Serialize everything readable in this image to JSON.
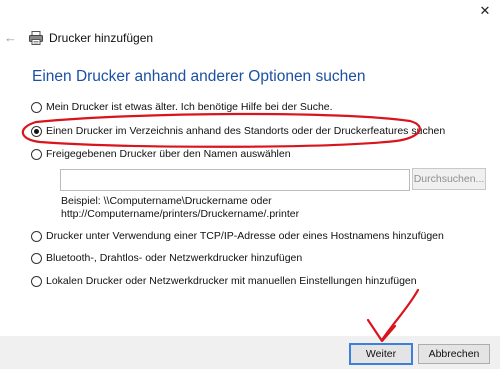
{
  "window": {
    "close_glyph": "✕",
    "back_glyph": "←",
    "title": "Drucker hinzufügen"
  },
  "heading": "Einen Drucker anhand anderer Optionen suchen",
  "options": [
    {
      "label": "Mein Drucker ist etwas älter. Ich benötige Hilfe bei der Suche.",
      "checked": false
    },
    {
      "label": "Einen Drucker im Verzeichnis anhand des Standorts oder der Druckerfeatures suchen",
      "checked": true
    },
    {
      "label": "Freigegebenen Drucker über den Namen auswählen",
      "checked": false
    },
    {
      "label": "Drucker unter Verwendung einer TCP/IP-Adresse oder eines Hostnamens hinzufügen",
      "checked": false
    },
    {
      "label": "Bluetooth-, Drahtlos- oder Netzwerkdrucker hinzufügen",
      "checked": false
    },
    {
      "label": "Lokalen Drucker oder Netzwerkdrucker mit manuellen Einstellungen hinzufügen",
      "checked": false
    }
  ],
  "shared_printer": {
    "input_value": "",
    "browse_label": "Durchsuchen...",
    "example_line1": "Beispiel: \\\\Computername\\Druckername oder",
    "example_line2": "http://Computername/printers/Druckername/.printer"
  },
  "footer": {
    "next_label": "Weiter",
    "cancel_label": "Abbrechen"
  },
  "colors": {
    "heading": "#1c50a4",
    "annotation": "#d9141c",
    "primary_button_border": "#3c7fdc"
  },
  "icons": {
    "close": "close-icon",
    "back": "back-arrow-icon",
    "printer": "printer-icon"
  }
}
